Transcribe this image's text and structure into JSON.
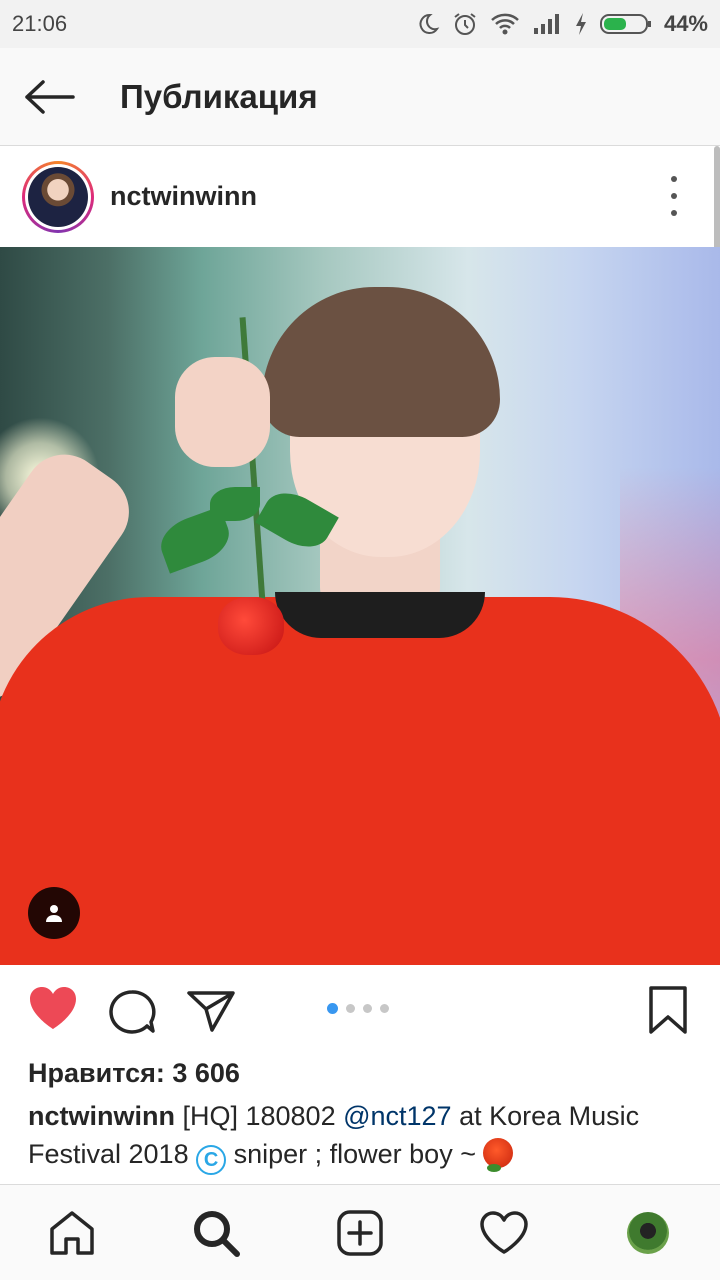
{
  "status_bar": {
    "time": "21:06",
    "battery": "44%",
    "icons": [
      "moon-icon",
      "alarm-icon",
      "wifi-icon",
      "signal-icon",
      "charging-icon",
      "battery-icon"
    ]
  },
  "app_bar": {
    "title": "Публикация",
    "back_icon": "arrow-left-icon"
  },
  "post": {
    "username": "nctwinwinn",
    "likes_text": "Нравится: 3 606",
    "caption": {
      "user": "nctwinwinn",
      "part1": " [HQ] 180802 ",
      "mention": "@nct127",
      "part2": " at Korea Music Festival 2018 ",
      "badge": "C",
      "part3": " sniper ; flower boy ~ "
    },
    "carousel": {
      "count": 4,
      "active_index": 0
    }
  },
  "colors": {
    "like": "#ed4956",
    "accent": "#3897f0",
    "mention": "#003569"
  },
  "bottom_nav": [
    "home-icon",
    "search-icon",
    "add-post-icon",
    "activity-heart-icon",
    "profile-avatar"
  ]
}
